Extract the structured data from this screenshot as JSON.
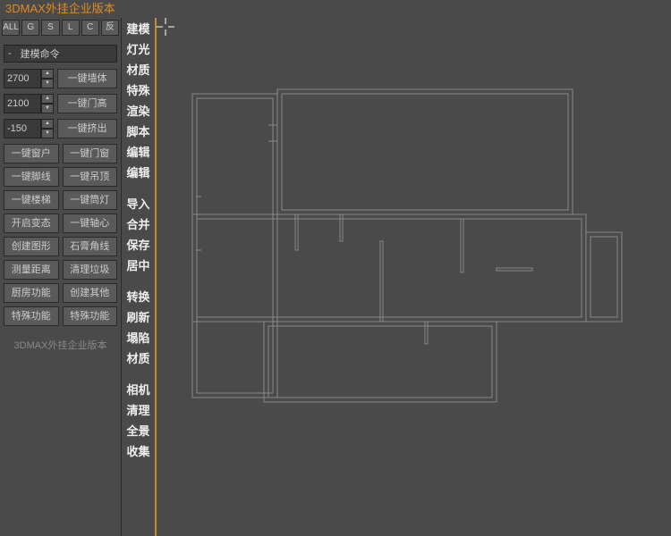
{
  "title": "3DMAX外挂企业版本",
  "filters": [
    "ALL",
    "G",
    "S",
    "L",
    "C",
    "反"
  ],
  "command_header_prefix": "-",
  "command_header_label": "建模命令",
  "params": [
    {
      "value": "2700",
      "btn": "一键墙体"
    },
    {
      "value": "2100",
      "btn": "一键门高"
    },
    {
      "value": "-150",
      "btn": "一键挤出"
    }
  ],
  "tool_pairs": [
    [
      "一键窗户",
      "一键门窗"
    ],
    [
      "一键脚线",
      "一键吊顶"
    ],
    [
      "一键楼梯",
      "一键筒灯"
    ],
    [
      "开启变态",
      "一键轴心"
    ],
    [
      "创建图形",
      "石膏角线"
    ],
    [
      "测量距离",
      "清理垃圾"
    ],
    [
      "厨房功能",
      "创建其他"
    ],
    [
      "特殊功能",
      "特殊功能"
    ]
  ],
  "footer_text": "3DMAX外挂企业版本",
  "side_menu": [
    [
      "建模",
      "灯光",
      "材质",
      "特殊",
      "渲染",
      "脚本",
      "编辑",
      "编辑"
    ],
    [
      "导入",
      "合并",
      "保存",
      "居中"
    ],
    [
      "转换",
      "刷新",
      "塌陷",
      "材质"
    ],
    [
      "相机",
      "清理",
      "全景",
      "收集"
    ]
  ]
}
